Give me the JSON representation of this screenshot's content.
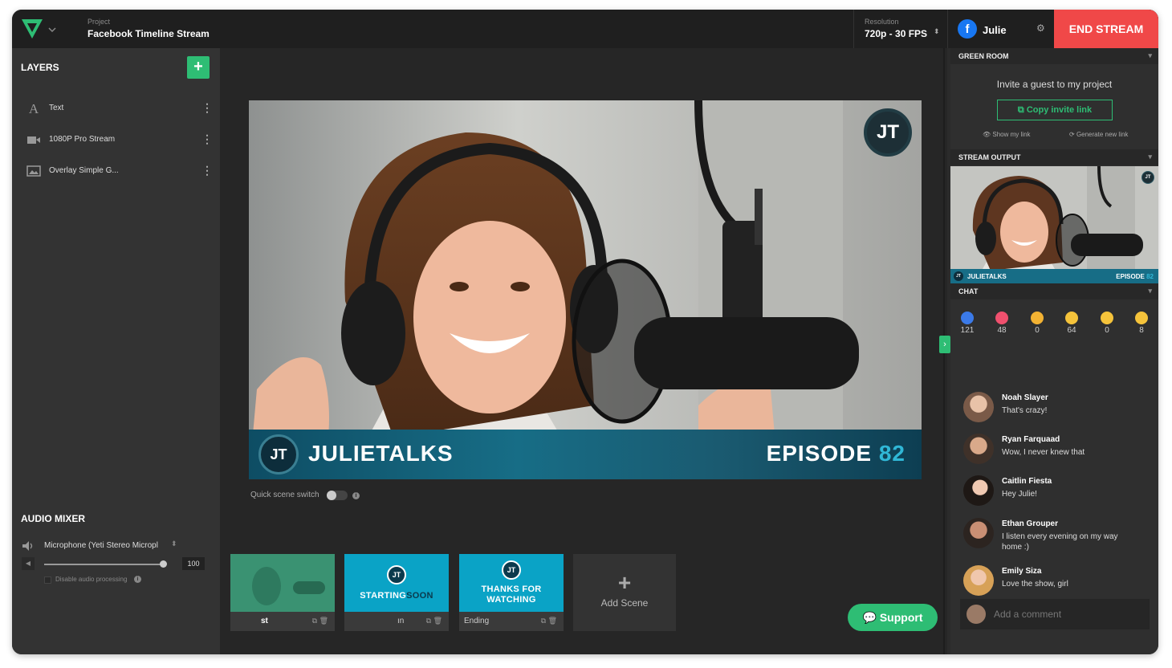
{
  "topbar": {
    "project_label": "Project",
    "project_name": "Facebook Timeline Stream",
    "resolution_label": "Resolution",
    "resolution_value": "720p - 30 FPS",
    "user_name": "Julie",
    "end_stream_label": "END STREAM"
  },
  "layers": {
    "title": "LAYERS",
    "items": [
      {
        "label": "Text",
        "icon": "text-icon"
      },
      {
        "label": "1080P Pro Stream",
        "icon": "camera-icon"
      },
      {
        "label": "Overlay Simple G...",
        "icon": "image-icon"
      }
    ]
  },
  "audio_mixer": {
    "title": "AUDIO MIXER",
    "device": "Microphone (Yeti Stereo Micropl",
    "volume": "100",
    "disable_label": "Disable audio processing"
  },
  "preview": {
    "badge": "JT",
    "brand_a": "JULIE",
    "brand_b": "TALKS",
    "episode_label": "EPISODE",
    "episode_number": "82",
    "quick_switch_label": "Quick scene switch"
  },
  "scenes": [
    {
      "name": "st",
      "thumb_text": ""
    },
    {
      "name": "ın",
      "thumb_text_a": "STARTING",
      "thumb_text_b": "SOON"
    },
    {
      "name": "Ending",
      "thumb_text": "THANKS FOR WATCHING"
    }
  ],
  "add_scene_label": "Add Scene",
  "support_label": "Support",
  "green_room": {
    "title": "GREEN ROOM",
    "invite_text": "Invite a guest to my project",
    "copy_label": "Copy invite link",
    "show_link": "Show my link",
    "generate_link": "Generate new link"
  },
  "stream_output": {
    "title": "STREAM OUTPUT",
    "brand_a": "JULIE",
    "brand_b": "TALKS",
    "episode_label": "EPISODE",
    "episode_number": "82",
    "badge": "JT"
  },
  "chat": {
    "title": "CHAT",
    "reactions": [
      {
        "icon": "like-icon",
        "count": "121",
        "color": "#3b7ae8"
      },
      {
        "icon": "love-icon",
        "count": "48",
        "color": "#f0506e"
      },
      {
        "icon": "haha-icon",
        "count": "0",
        "color": "#f2b233"
      },
      {
        "icon": "laugh-icon",
        "count": "64",
        "color": "#f5c33b"
      },
      {
        "icon": "sad-icon",
        "count": "0",
        "color": "#f5c33b"
      },
      {
        "icon": "wow-icon",
        "count": "8",
        "color": "#f5c33b"
      }
    ],
    "messages": [
      {
        "name": "Noah Slayer",
        "text": "That's crazy!"
      },
      {
        "name": "Ryan Farquaad",
        "text": "Wow, I never knew that"
      },
      {
        "name": "Caitlin Fiesta",
        "text": "Hey Julie!"
      },
      {
        "name": "Ethan Grouper",
        "text": "I listen every evening on my way home :)"
      },
      {
        "name": "Emily Siza",
        "text": "Love the show, girl"
      }
    ],
    "comment_placeholder": "Add a comment"
  }
}
